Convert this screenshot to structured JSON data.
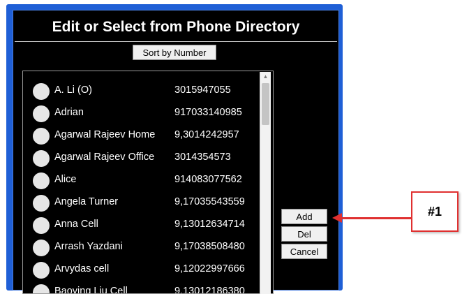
{
  "window": {
    "title": "Edit or Select from Phone Directory"
  },
  "toolbar": {
    "sort_label": "Sort by Number"
  },
  "directory": {
    "entries": [
      {
        "name": "A. Li (O)",
        "number": "3015947055"
      },
      {
        "name": "Adrian",
        "number": "917033140985"
      },
      {
        "name": "Agarwal Rajeev Home",
        "number": "9,3014242957"
      },
      {
        "name": "Agarwal Rajeev Office",
        "number": "3014354573"
      },
      {
        "name": "Alice",
        "number": "914083077562"
      },
      {
        "name": "Angela Turner",
        "number": "9,17035543559"
      },
      {
        "name": "Anna Cell",
        "number": "9,13012634714"
      },
      {
        "name": "Arrash Yazdani",
        "number": "9,17038508480"
      },
      {
        "name": "Arvydas cell",
        "number": "9,12022997666"
      },
      {
        "name": "Baoying Liu Cell",
        "number": "9,13012186380"
      }
    ]
  },
  "actions": {
    "add_label": "Add",
    "del_label": "Del",
    "cancel_label": "Cancel"
  },
  "annotation": {
    "label": "#1"
  },
  "colors": {
    "frame_blue": "#1f5fd6",
    "window_bg": "#000000",
    "annotation_red": "#e03030"
  }
}
